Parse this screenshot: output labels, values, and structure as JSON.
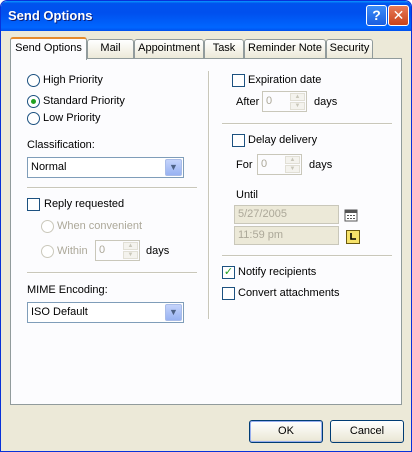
{
  "window": {
    "title": "Send Options"
  },
  "titlebar": {
    "help_glyph": "?",
    "close_glyph": "✕"
  },
  "tabs": [
    {
      "label": "Send Options"
    },
    {
      "label": "Mail"
    },
    {
      "label": "Appointment"
    },
    {
      "label": "Task"
    },
    {
      "label": "Reminder Note"
    },
    {
      "label": "Security"
    }
  ],
  "priority": {
    "high": "High Priority",
    "standard": "Standard Priority",
    "low": "Low Priority",
    "selected": "standard"
  },
  "classification": {
    "label": "Classification:",
    "value": "Normal"
  },
  "reply": {
    "label": "Reply requested",
    "checked": false,
    "when_convenient": "When convenient",
    "within": "Within",
    "within_value": "0",
    "days": "days"
  },
  "mime": {
    "label": "MIME Encoding:",
    "value": "ISO Default"
  },
  "expiration": {
    "label": "Expiration date",
    "checked": false,
    "after": "After",
    "value": "0",
    "days": "days"
  },
  "delay": {
    "label": "Delay delivery",
    "checked": false,
    "for": "For",
    "value": "0",
    "days": "days",
    "until": "Until",
    "date": "5/27/2005",
    "time": "11:59 pm"
  },
  "notify": {
    "label": "Notify recipients",
    "checked": true
  },
  "convert": {
    "label": "Convert attachments",
    "checked": false
  },
  "buttons": {
    "ok": "OK",
    "cancel": "Cancel"
  },
  "icons": {
    "help": "help-icon",
    "close": "close-icon",
    "calendar": "calendar-icon",
    "clock": "clock-icon",
    "dropdown": "chevron-down-icon",
    "spinner_up": "spin-up-icon",
    "spinner_down": "spin-down-icon"
  },
  "colors": {
    "titlebar": "#0054e3",
    "active_tab_accent": "#e68b2c",
    "check": "#21a121"
  }
}
